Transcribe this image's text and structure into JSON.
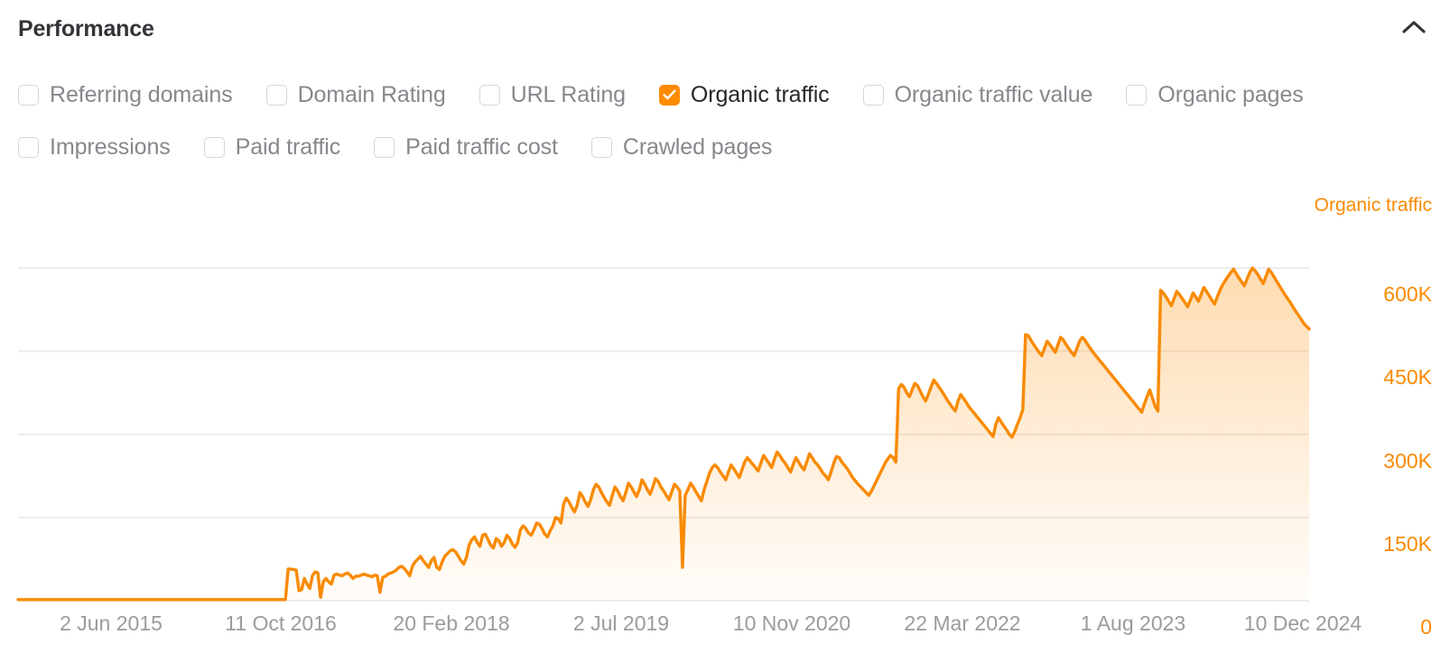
{
  "header": {
    "title": "Performance",
    "collapse_icon": "chevron-up-icon"
  },
  "metrics": {
    "rows": [
      [
        {
          "label": "Referring domains",
          "checked": false
        },
        {
          "label": "Domain Rating",
          "checked": false
        },
        {
          "label": "URL Rating",
          "checked": false
        },
        {
          "label": "Organic traffic",
          "checked": true
        },
        {
          "label": "Organic traffic value",
          "checked": false
        },
        {
          "label": "Organic pages",
          "checked": false
        }
      ],
      [
        {
          "label": "Impressions",
          "checked": false
        },
        {
          "label": "Paid traffic",
          "checked": false
        },
        {
          "label": "Paid traffic cost",
          "checked": false
        },
        {
          "label": "Crawled pages",
          "checked": false
        }
      ]
    ]
  },
  "colors": {
    "accent": "#ff8b00",
    "series": "#f98a00",
    "axis_text": "#9a9b9f",
    "gridline": "#ececec",
    "title": "#333438",
    "label_off": "#86888d"
  },
  "chart_data": {
    "type": "area",
    "title": "Organic traffic",
    "legend": [
      "Organic traffic"
    ],
    "legend_position": "top-right",
    "grid": true,
    "xlabel": "",
    "ylabel": "Organic traffic",
    "ylim": [
      0,
      750000
    ],
    "yticks": [
      0,
      150000,
      300000,
      450000,
      600000
    ],
    "ytick_labels": [
      "0",
      "150K",
      "300K",
      "450K",
      "600K"
    ],
    "xticks": [
      "2 Jun 2015",
      "11 Oct 2016",
      "20 Feb 2018",
      "2 Jul 2019",
      "10 Nov 2020",
      "22 Mar 2022",
      "1 Aug 2023",
      "10 Dec 2024"
    ],
    "x_start": "2 Jun 2015",
    "x_end": "10 Dec 2024",
    "series_name": "Organic traffic",
    "values": [
      2000,
      2000,
      2000,
      2000,
      2000,
      2000,
      2000,
      2000,
      2000,
      2000,
      2000,
      2000,
      2000,
      2000,
      2000,
      2000,
      2000,
      2000,
      2000,
      2000,
      2000,
      2000,
      2000,
      2000,
      2000,
      2000,
      2000,
      2000,
      2000,
      2000,
      2000,
      2000,
      2000,
      2000,
      2000,
      2000,
      2000,
      2000,
      2000,
      2000,
      2000,
      2000,
      2000,
      2000,
      2000,
      2000,
      2000,
      2000,
      2000,
      2000,
      2000,
      2000,
      2000,
      2000,
      2000,
      2000,
      2000,
      2000,
      2000,
      2000,
      2000,
      2000,
      2000,
      2000,
      2000,
      2000,
      2000,
      2000,
      2000,
      2000,
      2000,
      2000,
      2000,
      2000,
      2000,
      2000,
      2000,
      2000,
      2000,
      2000,
      2000,
      2000,
      2000,
      2000,
      2000,
      2000,
      2000,
      2000,
      2000,
      2000,
      2000,
      2000,
      2000,
      2000,
      2000,
      2000,
      2000,
      2000,
      2000,
      2000,
      57000,
      57000,
      56000,
      55000,
      18000,
      20000,
      40000,
      30000,
      22000,
      45000,
      52000,
      50000,
      6000,
      34000,
      40000,
      34000,
      30000,
      46000,
      48000,
      46000,
      45000,
      48000,
      50000,
      46000,
      40000,
      44000,
      44000,
      46000,
      48000,
      46000,
      45000,
      43000,
      46000,
      45000,
      15000,
      42000,
      44000,
      48000,
      50000,
      52000,
      55000,
      60000,
      62000,
      58000,
      52000,
      45000,
      62000,
      70000,
      75000,
      80000,
      72000,
      66000,
      60000,
      72000,
      78000,
      60000,
      56000,
      70000,
      80000,
      85000,
      90000,
      92000,
      88000,
      80000,
      72000,
      66000,
      78000,
      100000,
      110000,
      115000,
      105000,
      98000,
      118000,
      120000,
      110000,
      100000,
      95000,
      112000,
      108000,
      98000,
      105000,
      118000,
      112000,
      102000,
      96000,
      105000,
      128000,
      135000,
      130000,
      122000,
      118000,
      128000,
      140000,
      138000,
      130000,
      120000,
      115000,
      126000,
      135000,
      150000,
      148000,
      140000,
      175000,
      185000,
      178000,
      168000,
      160000,
      172000,
      195000,
      188000,
      178000,
      170000,
      182000,
      200000,
      210000,
      205000,
      195000,
      186000,
      178000,
      172000,
      190000,
      205000,
      198000,
      188000,
      180000,
      195000,
      212000,
      205000,
      196000,
      188000,
      200000,
      218000,
      210000,
      200000,
      192000,
      205000,
      220000,
      215000,
      205000,
      198000,
      190000,
      182000,
      196000,
      210000,
      205000,
      198000,
      60000,
      190000,
      200000,
      212000,
      205000,
      196000,
      188000,
      180000,
      200000,
      215000,
      230000,
      240000,
      245000,
      240000,
      232000,
      225000,
      218000,
      232000,
      245000,
      238000,
      230000,
      222000,
      236000,
      250000,
      258000,
      252000,
      246000,
      240000,
      234000,
      248000,
      262000,
      255000,
      248000,
      240000,
      255000,
      268000,
      262000,
      254000,
      248000,
      240000,
      232000,
      246000,
      258000,
      250000,
      242000,
      236000,
      250000,
      265000,
      258000,
      250000,
      245000,
      238000,
      230000,
      225000,
      218000,
      232000,
      248000,
      260000,
      258000,
      250000,
      244000,
      238000,
      230000,
      222000,
      216000,
      210000,
      205000,
      200000,
      195000,
      190000,
      198000,
      208000,
      218000,
      228000,
      238000,
      248000,
      256000,
      262000,
      258000,
      250000,
      382000,
      390000,
      385000,
      375000,
      368000,
      380000,
      392000,
      388000,
      378000,
      368000,
      360000,
      372000,
      385000,
      398000,
      392000,
      385000,
      378000,
      370000,
      362000,
      355000,
      348000,
      342000,
      360000,
      372000,
      365000,
      358000,
      350000,
      344000,
      338000,
      332000,
      326000,
      320000,
      314000,
      308000,
      302000,
      296000,
      318000,
      330000,
      322000,
      315000,
      308000,
      300000,
      295000,
      305000,
      318000,
      330000,
      345000,
      480000,
      478000,
      470000,
      462000,
      455000,
      448000,
      442000,
      455000,
      468000,
      462000,
      455000,
      448000,
      462000,
      475000,
      470000,
      462000,
      455000,
      448000,
      442000,
      455000,
      468000,
      475000,
      470000,
      462000,
      455000,
      448000,
      442000,
      436000,
      430000,
      424000,
      418000,
      412000,
      406000,
      400000,
      394000,
      388000,
      382000,
      376000,
      370000,
      364000,
      358000,
      352000,
      346000,
      340000,
      355000,
      368000,
      380000,
      365000,
      350000,
      342000,
      560000,
      555000,
      548000,
      540000,
      532000,
      545000,
      558000,
      552000,
      545000,
      538000,
      530000,
      542000,
      555000,
      548000,
      540000,
      552000,
      565000,
      558000,
      550000,
      542000,
      535000,
      548000,
      560000,
      570000,
      578000,
      585000,
      592000,
      598000,
      590000,
      582000,
      575000,
      568000,
      580000,
      592000,
      600000,
      595000,
      588000,
      580000,
      572000,
      585000,
      598000,
      592000,
      584000,
      576000,
      568000,
      560000,
      552000,
      545000,
      538000,
      530000,
      522000,
      515000,
      508000,
      500000,
      495000,
      490000
    ]
  }
}
